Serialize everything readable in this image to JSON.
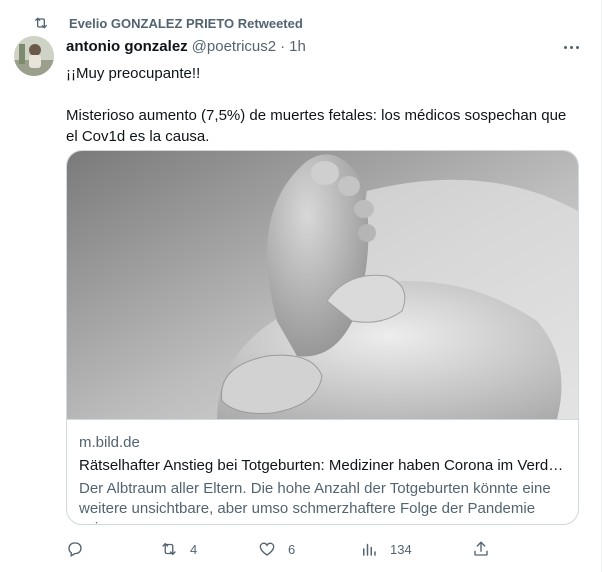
{
  "retweet_banner": {
    "text": "Evelio GONZALEZ PRIETO Retweeted"
  },
  "author": {
    "name": "antonio gonzalez",
    "handle": "@poetricus2",
    "separator": "·",
    "time": "1h"
  },
  "tweet": {
    "line1": "¡¡Muy preocupante!!",
    "line2": "Misterioso aumento (7,5%) de muertes fetales: los médicos sospechan que el Cov1d es la causa."
  },
  "card": {
    "domain": "m.bild.de",
    "title": "Rätselhafter Anstieg bei Totgeburten: Mediziner haben Corona im Verdacht",
    "description": "Der Albtraum aller Eltern. Die hohe Anzahl der Totgeburten könnte eine weitere unsichtbare, aber umso schmerzhaftere Folge der Pandemie sein."
  },
  "actions": {
    "replies": "",
    "retweets": "4",
    "likes": "6",
    "views": "134"
  },
  "icons": {
    "retweet": "retweet-icon",
    "reply": "reply-icon",
    "like": "heart-icon",
    "views": "views-icon",
    "share": "share-icon",
    "more": "more-icon"
  }
}
